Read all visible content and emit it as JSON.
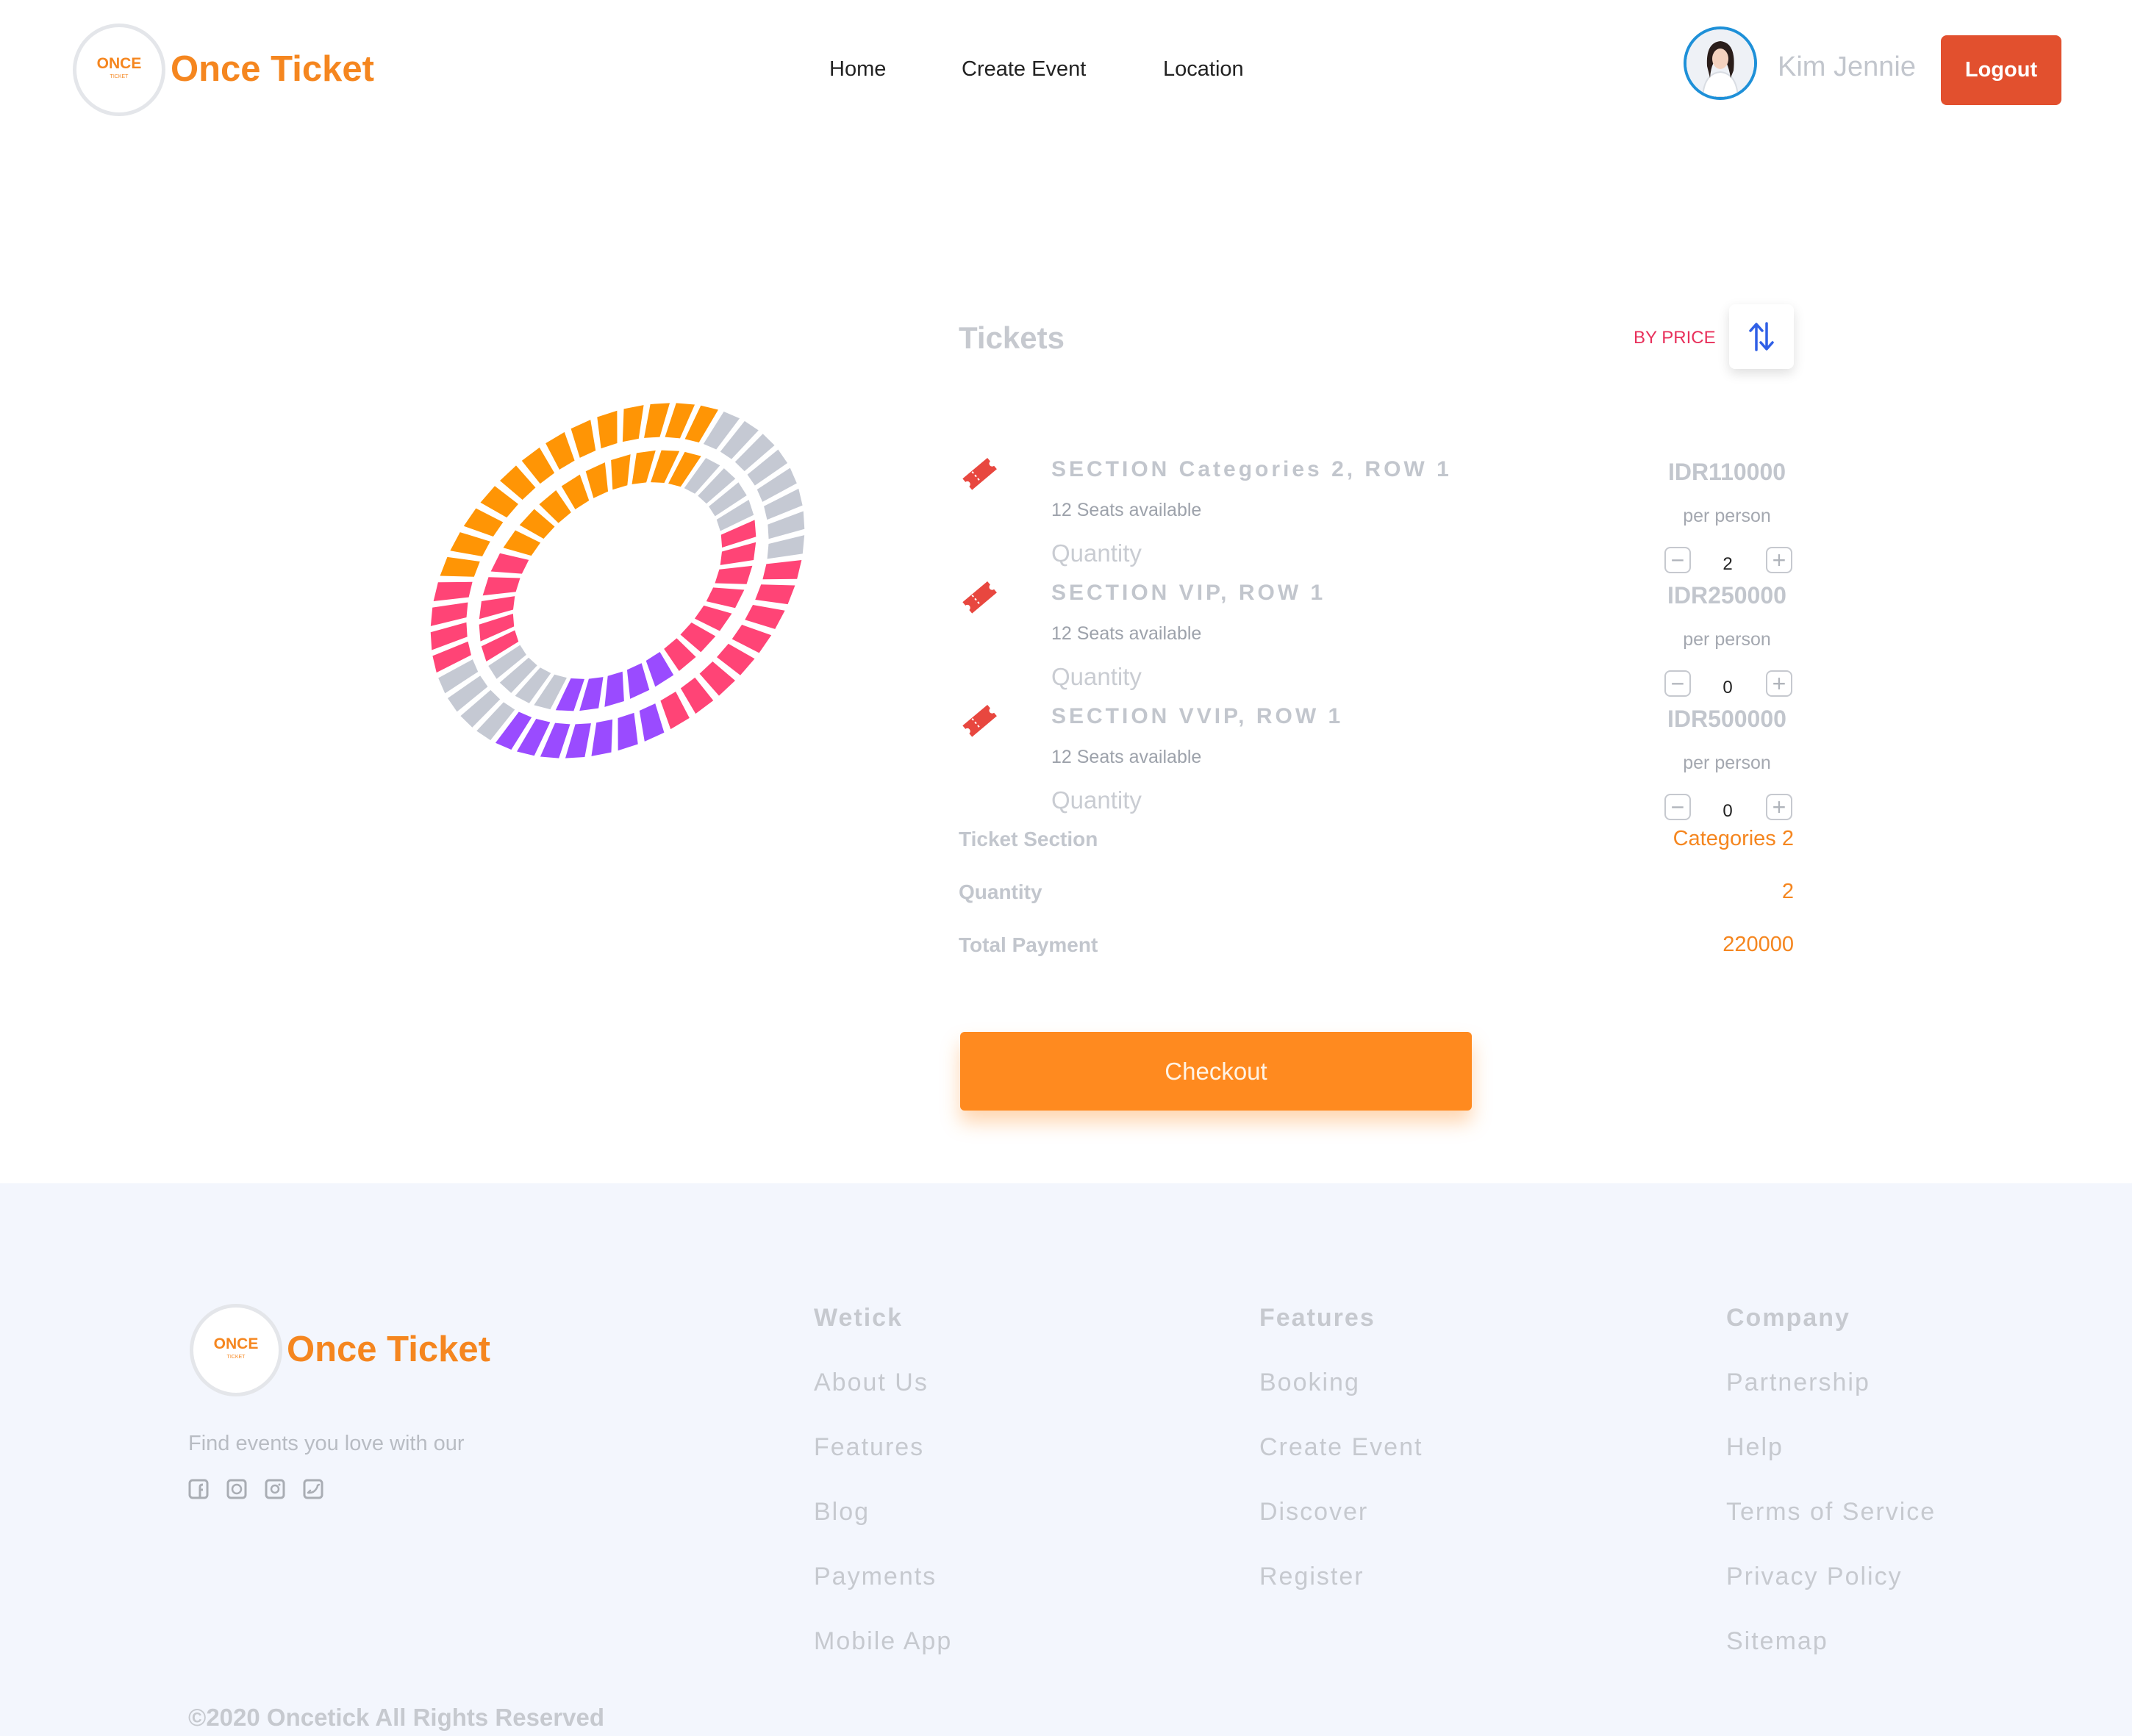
{
  "header": {
    "logo_mark": "ONCE",
    "logo_sub": "TICKET",
    "brand": "Once Ticket",
    "nav": [
      {
        "label": "Home"
      },
      {
        "label": "Create Event"
      },
      {
        "label": "Location"
      }
    ],
    "user_name": "Kim Jennie",
    "logout_label": "Logout"
  },
  "tickets": {
    "title": "Tickets",
    "sort_label": "BY PRICE",
    "sort_icon": "sort-arrows-icon",
    "items": [
      {
        "section": "SECTION Categories 2, ROW 1",
        "seats": "12 Seats available",
        "quantity_label": "Quantity",
        "price": "IDR110000",
        "per": "per person",
        "qty": "2"
      },
      {
        "section": "SECTION VIP, ROW 1",
        "seats": "12 Seats available",
        "quantity_label": "Quantity",
        "price": "IDR250000",
        "per": "per person",
        "qty": "0"
      },
      {
        "section": "SECTION VVIP, ROW 1",
        "seats": "12 Seats available",
        "quantity_label": "Quantity",
        "price": "IDR500000",
        "per": "per person",
        "qty": "0"
      }
    ]
  },
  "summary": {
    "section_label": "Ticket Section",
    "section_value": "Categories 2",
    "quantity_label": "Quantity",
    "quantity_value": "2",
    "total_label": "Total Payment",
    "total_value": "220000"
  },
  "checkout_label": "Checkout",
  "stadium_colors": {
    "orange": "#ff9505",
    "pink": "#ff4476",
    "purple": "#9a4bff",
    "gray": "#c5c9d3"
  },
  "footer": {
    "brand": "Once Ticket",
    "tagline": "Find events you love with our",
    "socials": [
      "facebook-icon",
      "whatsapp-icon",
      "instagram-icon",
      "twitter-icon"
    ],
    "columns": [
      {
        "title": "Wetick",
        "links": [
          "About Us",
          "Features",
          "Blog",
          "Payments",
          "Mobile App"
        ]
      },
      {
        "title": "Features",
        "links": [
          "Booking",
          "Create Event",
          "Discover",
          "Register"
        ]
      },
      {
        "title": "Company",
        "links": [
          "Partnership",
          "Help",
          "Terms of Service",
          "Privacy Policy",
          "Sitemap"
        ]
      }
    ],
    "copyright": "©2020 Oncetick All Rights Reserved"
  },
  "colors": {
    "accent": "#f5861f",
    "logout": "#e2502e",
    "checkout": "#ff8a1f",
    "sort_accent": "#e8305b"
  }
}
